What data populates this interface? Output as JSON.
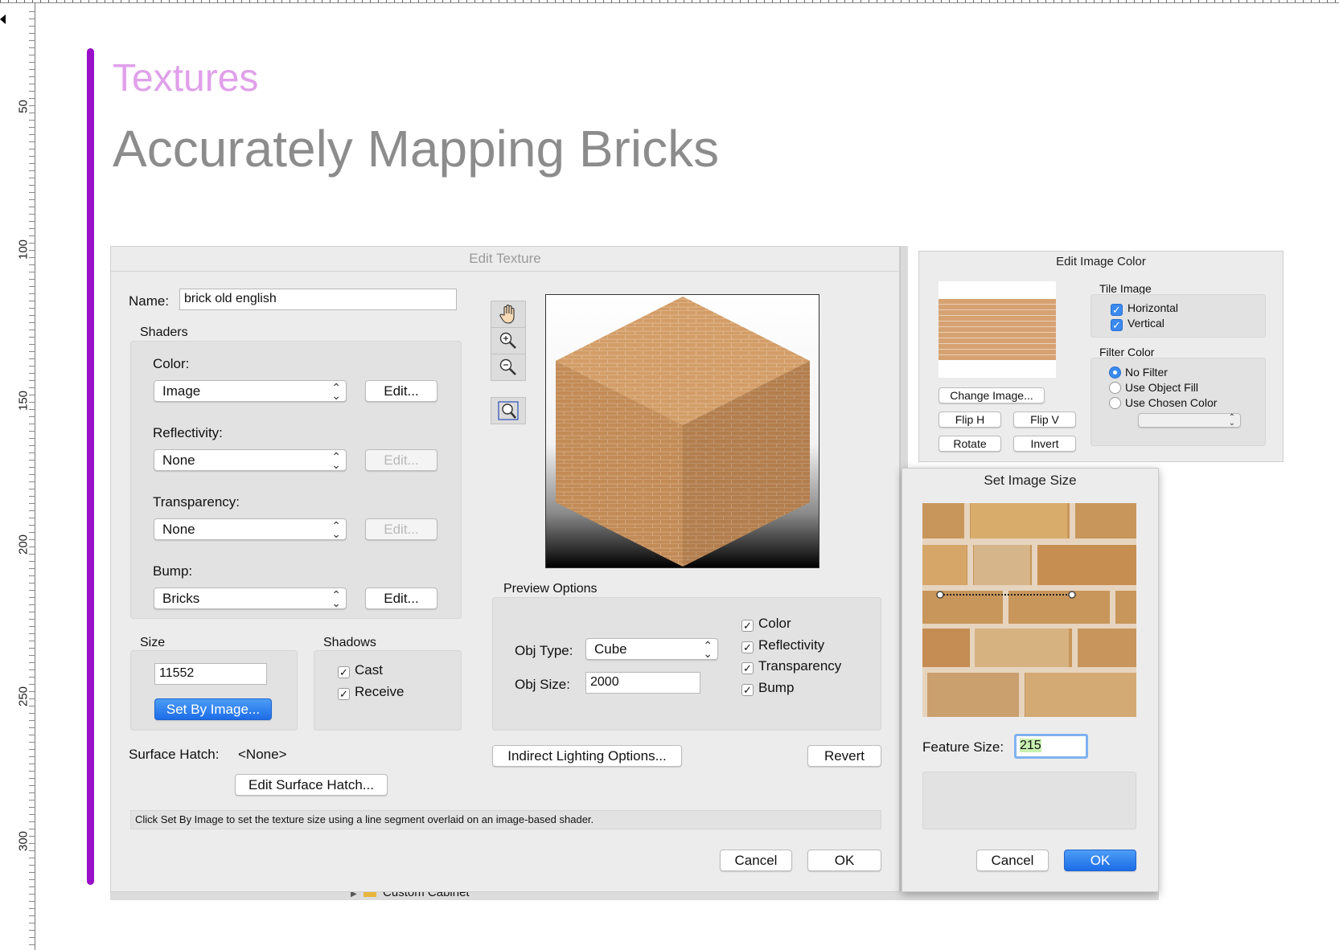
{
  "slide": {
    "section_title": "Textures",
    "title": "Accurately Mapping Bricks"
  },
  "ruler": {
    "labels": [
      "50",
      "100",
      "150",
      "200",
      "250",
      "300"
    ]
  },
  "colors": {
    "accent_bar": "#9810c8",
    "section_title": "#e0a0ea",
    "title": "#8c8c8c",
    "primary_button": "#1c6ce8"
  },
  "edit_texture": {
    "title": "Edit Texture",
    "name_label": "Name:",
    "name_value": "brick old english",
    "shaders_label": "Shaders",
    "color_label": "Color:",
    "color_value": "Image",
    "reflectivity_label": "Reflectivity:",
    "reflectivity_value": "None",
    "transparency_label": "Transparency:",
    "transparency_value": "None",
    "bump_label": "Bump:",
    "bump_value": "Bricks",
    "edit_label": "Edit...",
    "size_label": "Size",
    "size_value": "11552",
    "set_by_image_label": "Set By Image...",
    "shadows_label": "Shadows",
    "cast_label": "Cast",
    "receive_label": "Receive",
    "surface_hatch_label": "Surface Hatch:",
    "surface_hatch_value": "<None>",
    "edit_surface_hatch_label": "Edit Surface Hatch...",
    "preview_options_label": "Preview Options",
    "obj_type_label": "Obj Type:",
    "obj_type_value": "Cube",
    "obj_size_label": "Obj Size:",
    "obj_size_value": "2000",
    "preview_color_label": "Color",
    "preview_reflectivity_label": "Reflectivity",
    "preview_transparency_label": "Transparency",
    "preview_bump_label": "Bump",
    "indirect_lighting_label": "Indirect Lighting Options...",
    "revert_label": "Revert",
    "help_text": "Click Set By Image to set the texture size using a line segment overlaid on an image-based shader.",
    "cancel_label": "Cancel",
    "ok_label": "OK",
    "tools": [
      "hand-icon",
      "zoom-in-icon",
      "zoom-out-icon",
      "zoom-fit-icon"
    ]
  },
  "edit_image_color": {
    "title": "Edit Image Color",
    "tile_image_label": "Tile Image",
    "horizontal_label": "Horizontal",
    "vertical_label": "Vertical",
    "filter_color_label": "Filter Color",
    "no_filter_label": "No Filter",
    "use_object_fill_label": "Use Object Fill",
    "use_chosen_color_label": "Use Chosen Color",
    "change_image_label": "Change Image...",
    "flip_h_label": "Flip H",
    "flip_v_label": "Flip V",
    "rotate_label": "Rotate",
    "invert_label": "Invert"
  },
  "set_image_size": {
    "title": "Set Image Size",
    "feature_size_label": "Feature Size:",
    "feature_size_value": "215",
    "cancel_label": "Cancel",
    "ok_label": "OK"
  },
  "background": {
    "tree_item_label": "Custom Cabinet"
  }
}
